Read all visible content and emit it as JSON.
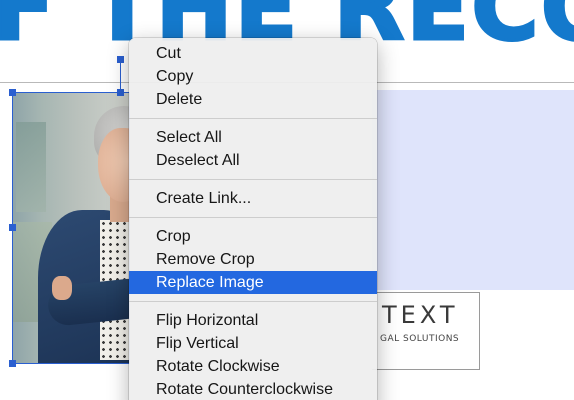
{
  "document": {
    "headline_fragment": "F THE RECO",
    "logo": {
      "main": "TEXT",
      "sub": "GAL SOLUTIONS"
    },
    "colors": {
      "headline": "#1479cc",
      "selection": "#2a5fd0",
      "blue_block": "#dfe4fb",
      "menu_highlight": "#2368e0"
    }
  },
  "context_menu": {
    "groups": [
      {
        "items": [
          {
            "label": "Cut"
          },
          {
            "label": "Copy"
          },
          {
            "label": "Delete"
          }
        ]
      },
      {
        "items": [
          {
            "label": "Select All"
          },
          {
            "label": "Deselect All"
          }
        ]
      },
      {
        "items": [
          {
            "label": "Create Link..."
          }
        ]
      },
      {
        "items": [
          {
            "label": "Crop"
          },
          {
            "label": "Remove Crop"
          },
          {
            "label": "Replace Image",
            "highlighted": true
          }
        ]
      },
      {
        "items": [
          {
            "label": "Flip Horizontal"
          },
          {
            "label": "Flip Vertical"
          },
          {
            "label": "Rotate Clockwise"
          },
          {
            "label": "Rotate Counterclockwise"
          }
        ]
      }
    ]
  }
}
